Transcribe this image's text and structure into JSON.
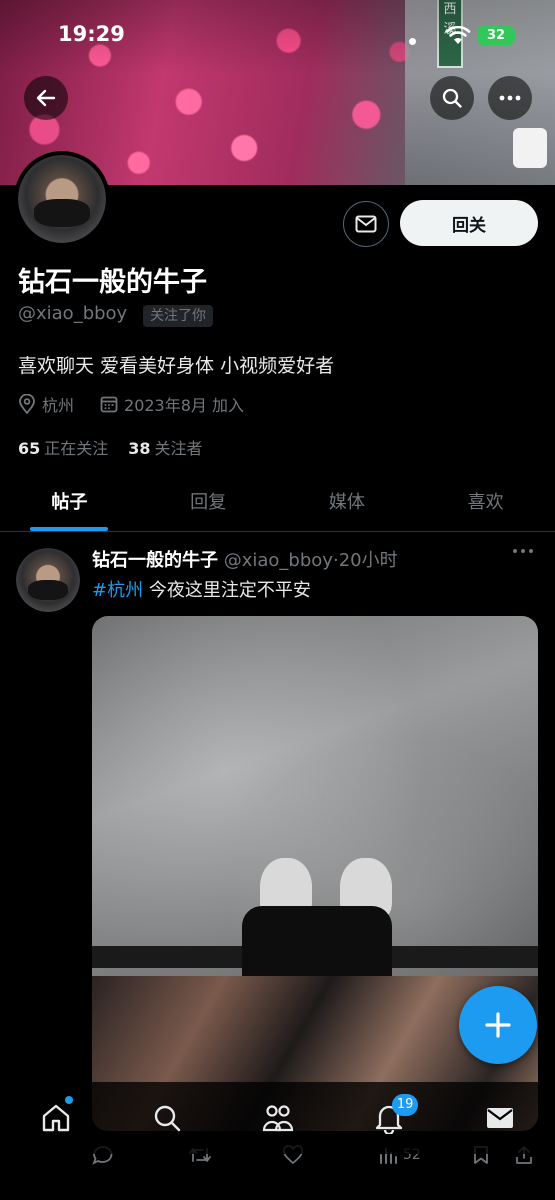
{
  "status_bar": {
    "time": "19:29",
    "battery": "32"
  },
  "banner": {
    "sign_text": "西溪"
  },
  "profile": {
    "name": "钻石一般的牛子",
    "handle": "@xiao_bboy",
    "follows_you": "关注了你",
    "bio": "喜欢聊天 爱看美好身体 小视频爱好者",
    "location": "杭州",
    "joined": "2023年8月 加入",
    "following_count": "65",
    "following_label": "正在关注",
    "followers_count": "38",
    "followers_label": "关注者",
    "follow_button": "回关"
  },
  "tabs": [
    {
      "label": "帖子",
      "active": true
    },
    {
      "label": "回复",
      "active": false
    },
    {
      "label": "媒体",
      "active": false
    },
    {
      "label": "喜欢",
      "active": false
    }
  ],
  "tweet": {
    "author": "钻石一般的牛子",
    "handle": "@xiao_bboy",
    "separator": "·",
    "time": "20小时",
    "hashtag": "#杭州",
    "text": "今夜这里注定不平安",
    "views": "52"
  },
  "bottom_nav": {
    "items": [
      "home-icon",
      "search-icon",
      "communities-icon",
      "bell-icon",
      "mail-icon"
    ],
    "notification_count": "19"
  },
  "colors": {
    "accent": "#1d9bf0",
    "secondary_text": "#71767b",
    "background": "#000000"
  }
}
